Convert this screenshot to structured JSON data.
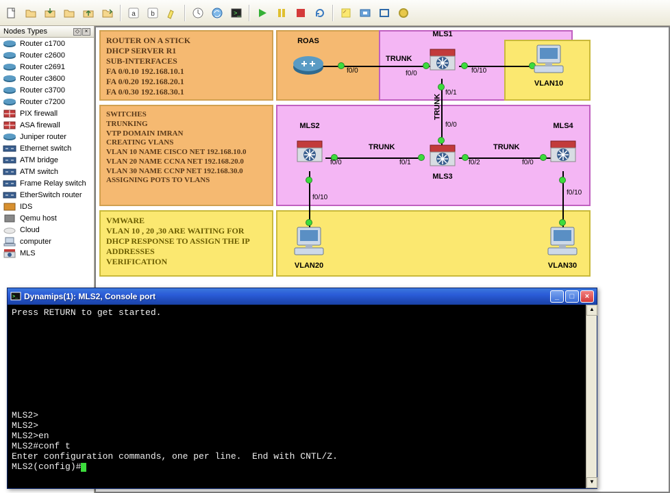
{
  "toolbar": {
    "icons": [
      "new-file",
      "open-folder",
      "mail-open",
      "folder",
      "save",
      "export",
      "spacer",
      "snap-a",
      "snap-b",
      "highlight",
      "spacer",
      "clock",
      "globe-refresh",
      "console",
      "spacer",
      "play",
      "pause",
      "stop",
      "reload",
      "spacer",
      "note",
      "screenshot",
      "rect-tool",
      "circle-tool"
    ]
  },
  "sidebar": {
    "title": "Nodes Types",
    "items": [
      {
        "label": "Router c1700",
        "icon": "router"
      },
      {
        "label": "Router c2600",
        "icon": "router"
      },
      {
        "label": "Router c2691",
        "icon": "router"
      },
      {
        "label": "Router c3600",
        "icon": "router"
      },
      {
        "label": "Router c3700",
        "icon": "router"
      },
      {
        "label": "Router c7200",
        "icon": "router"
      },
      {
        "label": "PIX firewall",
        "icon": "firewall"
      },
      {
        "label": "ASA firewall",
        "icon": "firewall"
      },
      {
        "label": "Juniper router",
        "icon": "router"
      },
      {
        "label": "Ethernet switch",
        "icon": "switch"
      },
      {
        "label": "ATM bridge",
        "icon": "switch"
      },
      {
        "label": "ATM switch",
        "icon": "switch"
      },
      {
        "label": "Frame Relay switch",
        "icon": "switch"
      },
      {
        "label": "EtherSwitch router",
        "icon": "switch"
      },
      {
        "label": "IDS",
        "icon": "ids"
      },
      {
        "label": "Qemu host",
        "icon": "host"
      },
      {
        "label": "Cloud",
        "icon": "cloud"
      },
      {
        "label": "computer",
        "icon": "pc"
      },
      {
        "label": "MLS",
        "icon": "mls"
      }
    ]
  },
  "notes": {
    "n1": {
      "lines": [
        "ROUTER ON A STICK",
        "DHCP SERVER R1",
        "SUB-INTERFACES",
        "FA 0/0.10 192.168.10.1",
        "FA 0/0.20 192.168.20.1",
        "FA 0/0.30 192.168.30.1"
      ]
    },
    "n2": {
      "lines": [
        "SWITCHES",
        "TRUNKING",
        "VTP DOMAIN IMRAN",
        "CREATING VLANS",
        "VLAN 10 NAME CISCO NET 192.168.10.0",
        "VLAN 20 NAME CCNA NET 192.168.20.0",
        "VLAN 30 NAME CCNP NET 192.168.30.0",
        "ASSIGNING POTS TO VLANS"
      ]
    },
    "n3": {
      "lines": [
        "VMWARE",
        "VLAN 10 , 20 ,30 ARE WAITING FOR",
        "DHCP RESPONSE TO ASSIGN THE IP",
        "ADDRESSES",
        "VERIFICATION"
      ]
    }
  },
  "devices": {
    "roas": {
      "label": "ROAS"
    },
    "mls1": {
      "label": "MLS1"
    },
    "mls2": {
      "label": "MLS2"
    },
    "mls3": {
      "label": "MLS3"
    },
    "mls4": {
      "label": "MLS4"
    },
    "vlan10": {
      "label": "VLAN10"
    },
    "vlan20": {
      "label": "VLAN20"
    },
    "vlan30": {
      "label": "VLAN30"
    }
  },
  "link_labels": {
    "trunk": "TRUNK",
    "f00": "f0/0",
    "f01": "f0/1",
    "f02": "f0/2",
    "f010": "f0/10"
  },
  "terminal": {
    "title": "Dynamips(1): MLS2, Console port",
    "lines": [
      "Press RETURN to get started.",
      "",
      "",
      "",
      "",
      "",
      "",
      "",
      "",
      "",
      "MLS2>",
      "MLS2>",
      "MLS2>en",
      "MLS2#conf t",
      "Enter configuration commands, one per line.  End with CNTL/Z.",
      "MLS2(config)#"
    ]
  }
}
